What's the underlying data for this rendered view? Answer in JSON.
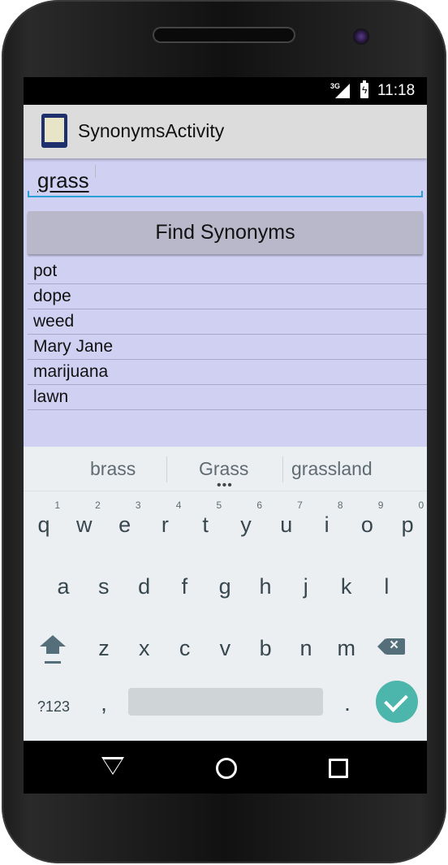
{
  "status_bar": {
    "network": "3G",
    "time": "11:18"
  },
  "action_bar": {
    "title": "SynonymsActivity"
  },
  "search": {
    "value": "grass"
  },
  "find_button": {
    "label": "Find Synonyms"
  },
  "synonyms": [
    "pot",
    "dope",
    "weed",
    "Mary Jane",
    "marijuana",
    "lawn"
  ],
  "keyboard": {
    "suggestions": [
      "brass",
      "Grass",
      "grassland"
    ],
    "row1": [
      {
        "letter": "q",
        "num": "1"
      },
      {
        "letter": "w",
        "num": "2"
      },
      {
        "letter": "e",
        "num": "3"
      },
      {
        "letter": "r",
        "num": "4"
      },
      {
        "letter": "t",
        "num": "5"
      },
      {
        "letter": "y",
        "num": "6"
      },
      {
        "letter": "u",
        "num": "7"
      },
      {
        "letter": "i",
        "num": "8"
      },
      {
        "letter": "o",
        "num": "9"
      },
      {
        "letter": "p",
        "num": "0"
      }
    ],
    "row2": [
      "a",
      "s",
      "d",
      "f",
      "g",
      "h",
      "j",
      "k",
      "l"
    ],
    "row3": [
      "z",
      "x",
      "c",
      "v",
      "b",
      "n",
      "m"
    ],
    "symbols_label": "?123",
    "comma": ",",
    "period": "."
  },
  "colors": {
    "content_bg": "#d0d0f2",
    "accent": "#2a9fd6",
    "enter_key": "#4db6ac"
  }
}
